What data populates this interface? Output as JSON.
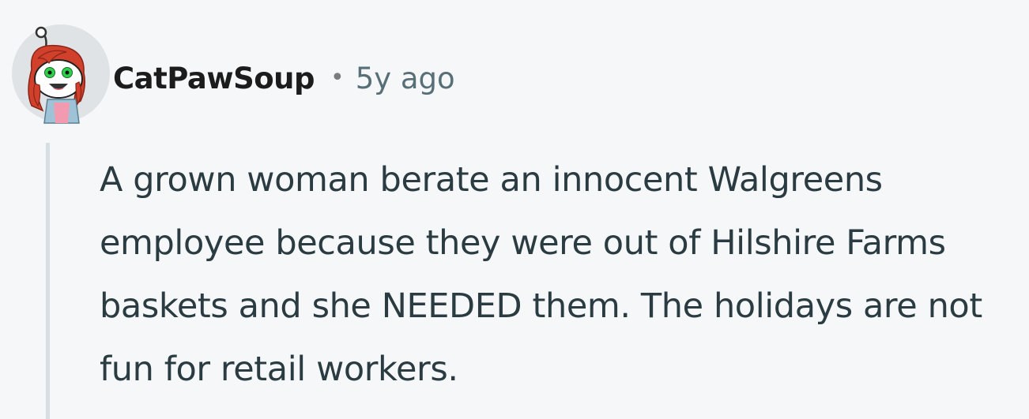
{
  "comment": {
    "username": "CatPawSoup",
    "separator": "•",
    "timestamp": "5y ago",
    "body": "A grown woman berate an innocent Walgreens employee because they were out of Hilshire Farms baskets and she NEEDED them. The holidays are not fun for retail workers."
  },
  "colors": {
    "background": "#f6f7f8",
    "username": "#1c1c1c",
    "timestamp": "#576f76",
    "body_text": "#2a3c42",
    "thread_line": "#d8dfe3"
  },
  "icons": {
    "avatar": "snoo-avatar-icon"
  }
}
